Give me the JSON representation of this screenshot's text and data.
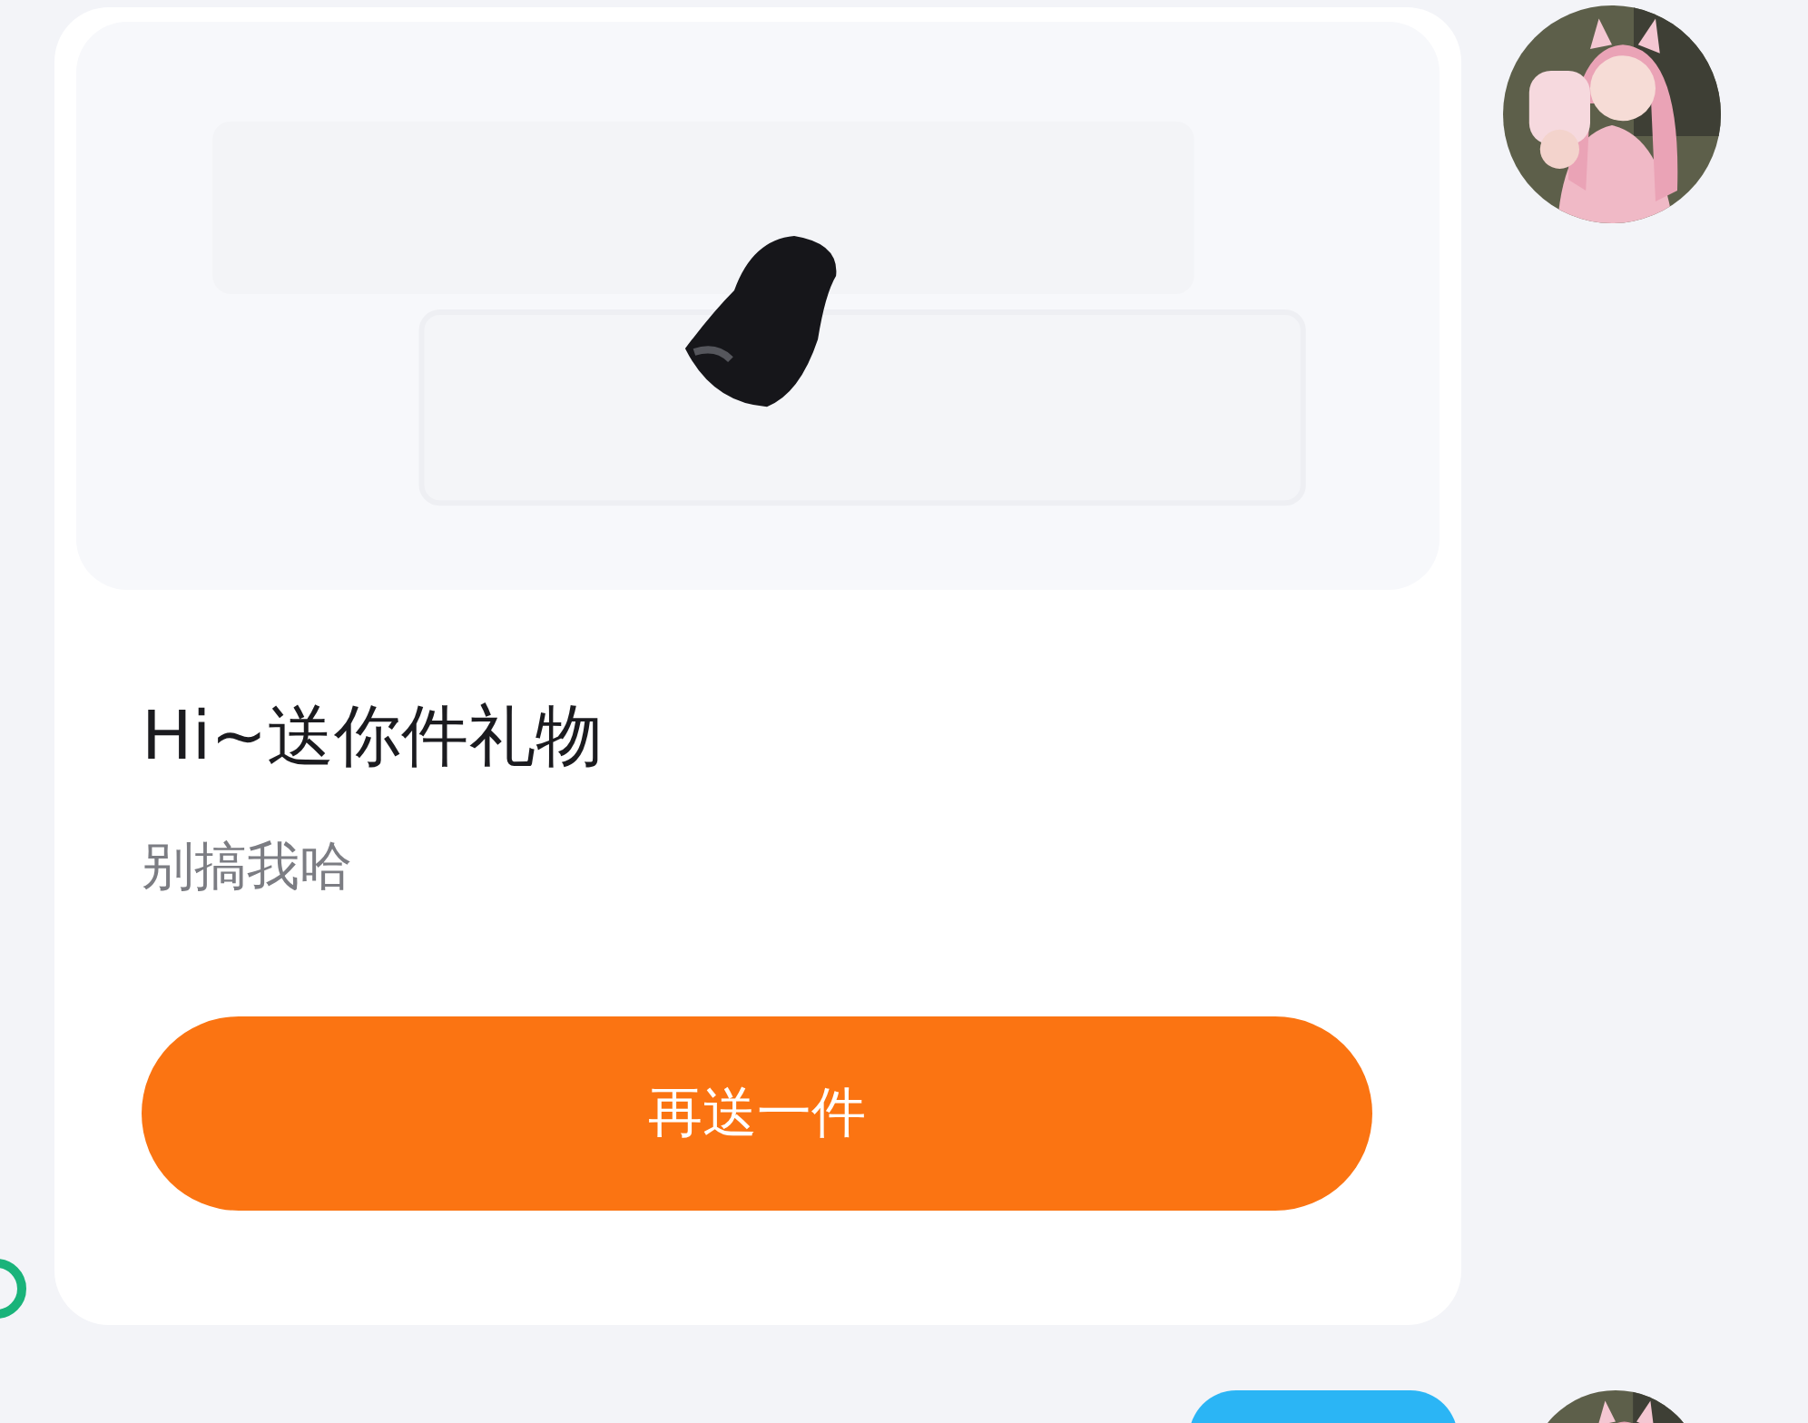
{
  "messages": [
    {
      "kind": "gift_card",
      "title": "Hi~送你件礼物",
      "subtitle": "别搞我哈",
      "button": "再送一件"
    },
    {
      "kind": "bubble"
    }
  ]
}
